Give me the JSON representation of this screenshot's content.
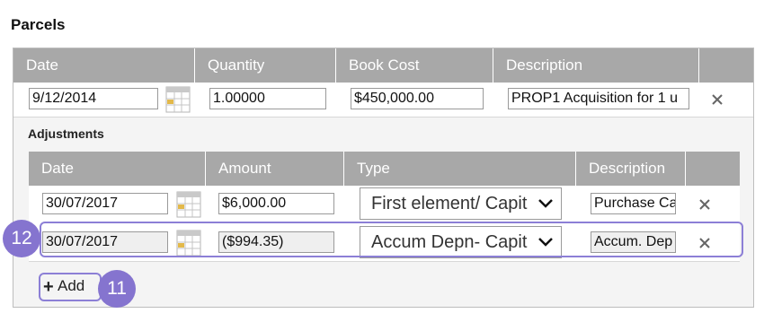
{
  "section_title": "Parcels",
  "parcel_table": {
    "headers": [
      "Date",
      "Quantity",
      "Book Cost",
      "Description"
    ],
    "row": {
      "date": "9/12/2014",
      "quantity": "1.00000",
      "book_cost": "$450,000.00",
      "description": "PROP1 Acquisition for 1 u"
    }
  },
  "adjustments": {
    "title": "Adjustments",
    "headers": [
      "Date",
      "Amount",
      "Type",
      "Description"
    ],
    "rows": [
      {
        "date": "30/07/2017",
        "amount": "$6,000.00",
        "type": "First element/ Capit",
        "description": "Purchase Ca"
      },
      {
        "date": "30/07/2017",
        "amount": "($994.35)",
        "type": "Accum Depn- Capit",
        "description": "Accum. Dep"
      }
    ],
    "add_label": "Add"
  },
  "callouts": {
    "row_badge": "12",
    "add_badge": "11"
  },
  "icons": {
    "delete": "close-icon",
    "calendar": "calendar-icon",
    "dropdown": "chevron-down-icon",
    "add": "plus-icon"
  },
  "colors": {
    "header_bg": "#a8a8a8",
    "highlight": "#8c7fd6",
    "badge": "#8574cf"
  }
}
